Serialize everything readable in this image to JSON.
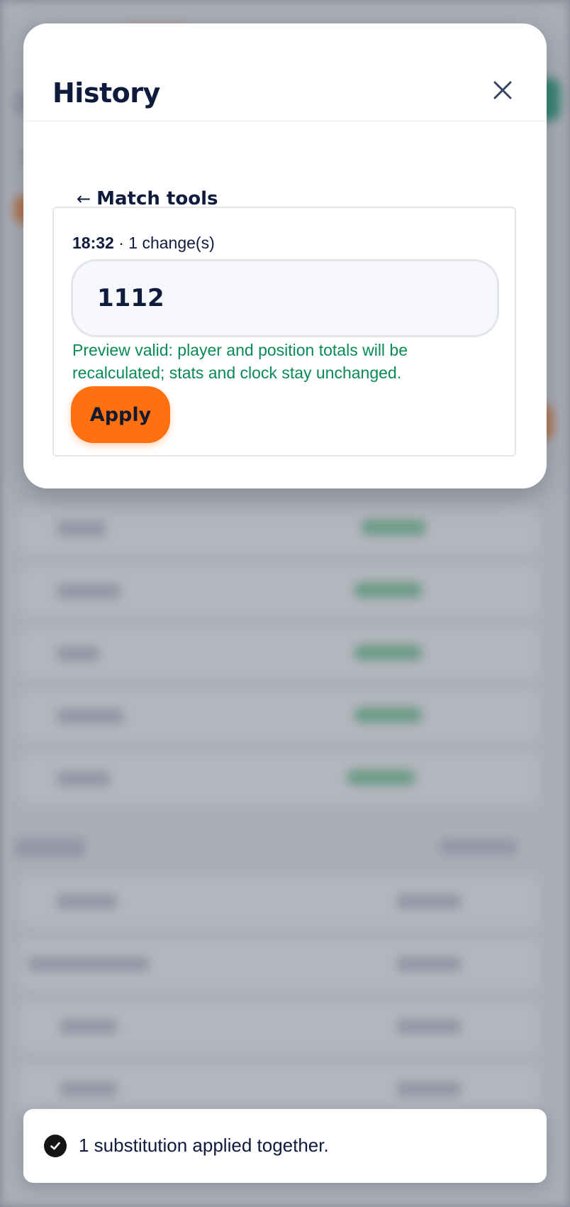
{
  "modal": {
    "title": "History",
    "close_icon": "close-icon",
    "back_link_arrow": "←",
    "back_link_label": "Match tools"
  },
  "history_entry": {
    "time": "18:32",
    "separator": "·",
    "changes": "1 change(s)",
    "input_value": "1112",
    "preview_message": "Preview valid: player and position totals will be recalculated; stats and clock stay unchanged.",
    "apply_label": "Apply"
  },
  "toast": {
    "icon": "check-circle-icon",
    "message": "1 substitution applied together."
  },
  "colors": {
    "accent": "#ff7110",
    "success": "#0a8a56",
    "heading": "#0f1b3d"
  }
}
